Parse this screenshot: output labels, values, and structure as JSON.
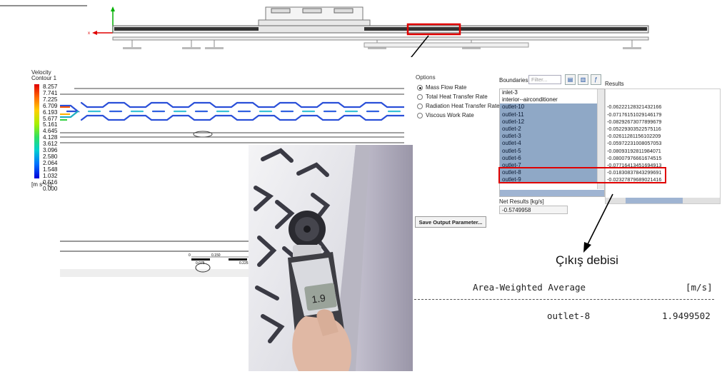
{
  "contour": {
    "title": "Velocity",
    "subtitle": "Contour 1",
    "legend_values": [
      "8.257",
      "7.741",
      "7.225",
      "6.709",
      "6.193",
      "5.677",
      "5.161",
      "4.645",
      "4.128",
      "3.612",
      "3.096",
      "2.580",
      "2.064",
      "1.548",
      "1.032",
      "0.516",
      "0.000"
    ],
    "unit": "[m s^-1]",
    "scale_labels": [
      "0",
      "0.150",
      "0.075",
      "0.225"
    ]
  },
  "report": {
    "options_label": "Options",
    "options": [
      {
        "label": "Mass Flow Rate",
        "selected": true
      },
      {
        "label": "Total Heat Transfer Rate",
        "selected": false
      },
      {
        "label": "Radiation Heat Transfer Rate",
        "selected": false
      },
      {
        "label": "Viscous Work Rate",
        "selected": false
      }
    ],
    "boundaries_label": "Boundaries",
    "filter_placeholder": "Filter...",
    "results_label": "Results",
    "boundaries": [
      {
        "name": "inlet-3",
        "selected": false
      },
      {
        "name": "interior--airconditioner",
        "selected": false
      },
      {
        "name": "outlet-10",
        "selected": true
      },
      {
        "name": "outlet-11",
        "selected": true
      },
      {
        "name": "outlet-12",
        "selected": true
      },
      {
        "name": "outlet-2",
        "selected": true
      },
      {
        "name": "outlet-3",
        "selected": true
      },
      {
        "name": "outlet-4",
        "selected": true
      },
      {
        "name": "outlet-5",
        "selected": true
      },
      {
        "name": "outlet-6",
        "selected": true
      },
      {
        "name": "outlet-7",
        "selected": true
      },
      {
        "name": "outlet-8",
        "selected": true
      },
      {
        "name": "outlet-9",
        "selected": true
      }
    ],
    "results": [
      "",
      "",
      "-0.06222128321432166",
      "-0.07176151029146179",
      "-0.08292673077899679",
      "-0.05229303522575116",
      "-0.02611281156102209",
      "-0.05972231008057053",
      "-0.08093192811984071",
      "-0.08007976661674515",
      "-0.07716413451694913",
      "-0.01830837843299691",
      "-0.02327879689021416"
    ],
    "net_results_label": "Net Results [kg/s]",
    "net_results_value": "-0.5749958",
    "save_button": "Save Output Parameter..."
  },
  "caption": "Çıkış debisi",
  "table": {
    "col1": "Area-Weighted Average",
    "col2": "[m/s]",
    "row_name": "outlet-8",
    "row_value": "1.9499502"
  },
  "colors": {
    "highlight": "#e00000",
    "selection": "#8fa8c6"
  }
}
